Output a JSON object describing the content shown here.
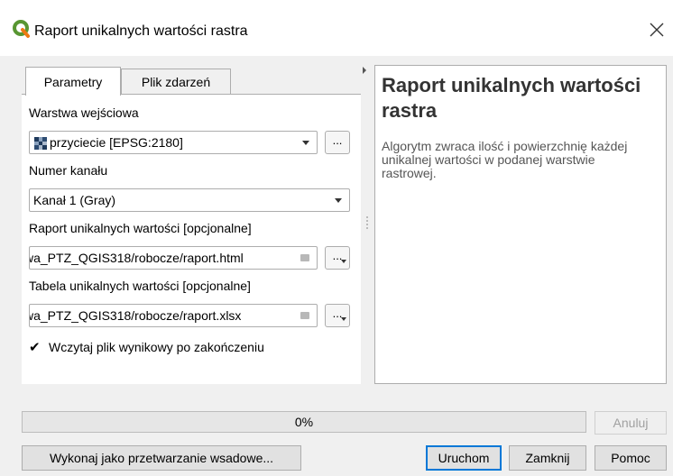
{
  "window": {
    "title": "Raport unikalnych wartości rastra",
    "icon": "qgis-logo-icon"
  },
  "tabs": [
    {
      "label": "Parametry",
      "active": true
    },
    {
      "label": "Plik zdarzeń",
      "active": false
    }
  ],
  "params": {
    "input_layer_label": "Warstwa wejściowa",
    "input_layer_value": "przyciecie [EPSG:2180]",
    "band_label": "Numer kanału",
    "band_value": "Kanał 1 (Gray)",
    "report_label": "Raport unikalnych wartości [opcjonalne]",
    "report_value": "wa_PTZ_QGIS318/robocze/raport.html",
    "table_label": "Tabela unikalnych wartości [opcjonalne]",
    "table_value": "wa_PTZ_QGIS318/robocze/raport.xlsx",
    "load_result_label": "Wczytaj plik wynikowy po zakończeniu",
    "load_result_checked": true,
    "browse_label": "..."
  },
  "help": {
    "title": "Raport unikalnych wartości rastra",
    "description": "Algorytm zwraca ilość i powierzchnię każdej unikalnej wartości w podanej warstwie rastrowej."
  },
  "progress": {
    "value": 0,
    "text": "0%"
  },
  "buttons": {
    "cancel": "Anuluj",
    "batch": "Wykonaj jako przetwarzanie wsadowe...",
    "run": "Uruchom",
    "close": "Zamknij",
    "help": "Pomoc"
  },
  "colors": {
    "accent": "#0078d7",
    "qgis_green": "#589632",
    "qgis_yellow": "#ee7913"
  }
}
